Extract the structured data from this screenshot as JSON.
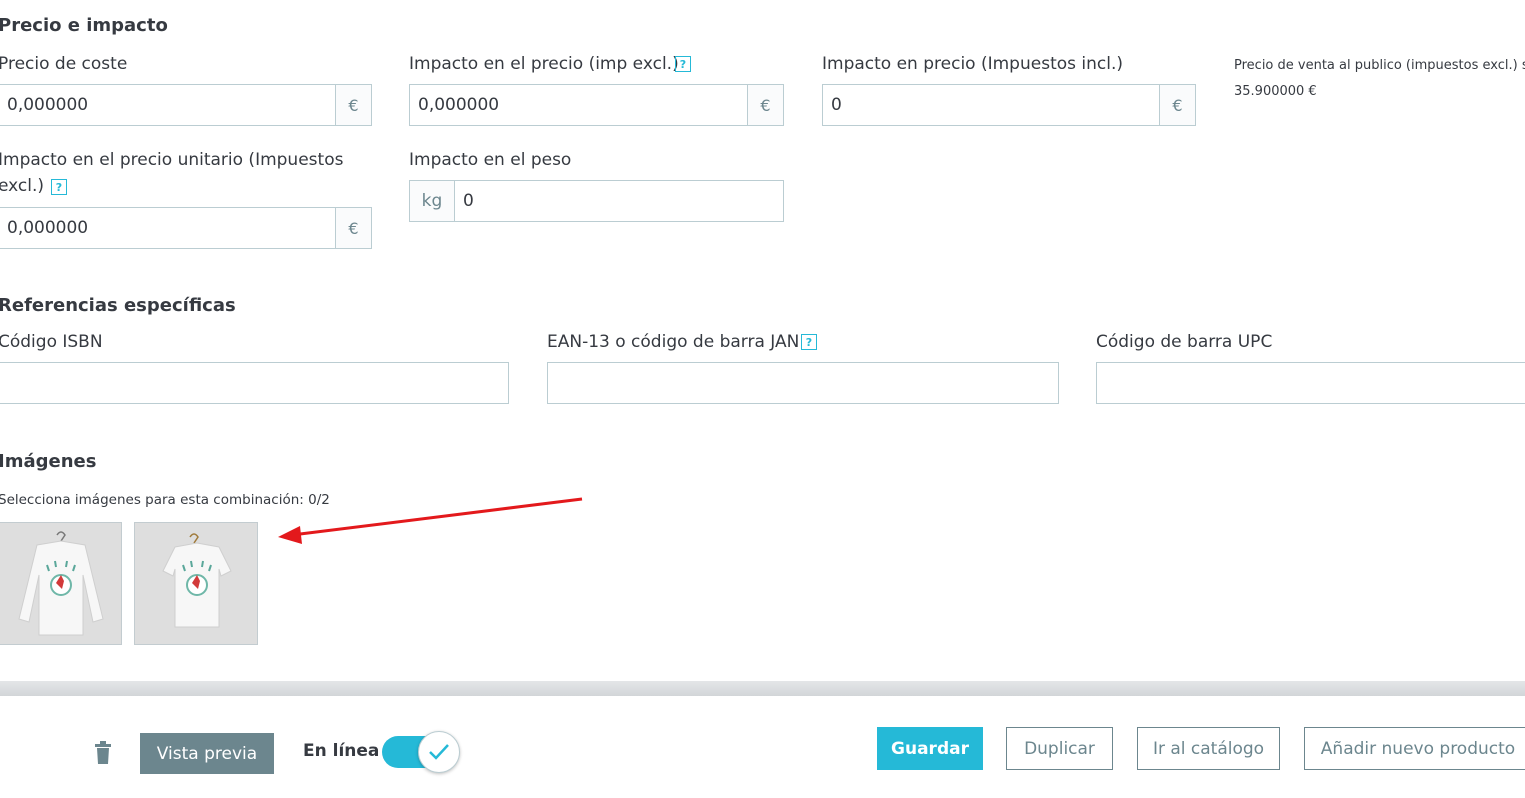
{
  "price_section": {
    "title": "Precio e impacto",
    "cost_price": {
      "label": "Precio de coste",
      "value": "0,000000",
      "currency": "€"
    },
    "impact_price_excl": {
      "label": "Impacto en el precio (imp excl.)",
      "value": "0,000000",
      "currency": "€"
    },
    "impact_price_incl": {
      "label": "Impacto en precio (Impuestos incl.)",
      "value": "0",
      "currency": "€"
    },
    "sale_price_info": {
      "label": "Precio de venta al publico (impuestos excl.) s",
      "value": "35.900000 €"
    },
    "unit_price_impact": {
      "label_line1": "Impacto en el precio unitario (Impuestos",
      "label_line2": "excl.)",
      "value": "0,000000",
      "currency": "€"
    },
    "weight_impact": {
      "label": "Impacto en el peso",
      "unit": "kg",
      "value": "0"
    },
    "help_glyph": "?"
  },
  "refs_section": {
    "title": "Referencias específicas",
    "isbn": {
      "label": "Código ISBN",
      "value": ""
    },
    "ean13": {
      "label": "EAN-13 o código de barra JAN",
      "value": ""
    },
    "upc": {
      "label": "Código de barra UPC",
      "value": ""
    }
  },
  "images_section": {
    "title": "Imágenes",
    "subtitle": "Selecciona imágenes para esta combinación: 0/2"
  },
  "footer": {
    "delete_icon": "trash-icon",
    "preview_label": "Vista previa",
    "online_label": "En línea",
    "online_enabled": true,
    "save_label": "Guardar",
    "duplicate_label": "Duplicar",
    "catalog_label": "Ir al catálogo",
    "new_product_label": "Añadir nuevo producto"
  },
  "colors": {
    "accent": "#25b9d7",
    "secondary": "#6c868e",
    "annotation_arrow": "#e3191c"
  }
}
